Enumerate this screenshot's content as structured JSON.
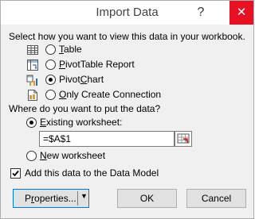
{
  "dialog": {
    "title": "Import Data",
    "help_glyph": "?",
    "close_glyph": "✕"
  },
  "view_section": {
    "prompt": "Select how you want to view this data in your workbook.",
    "options": [
      {
        "pre": "",
        "key": "T",
        "post": "able",
        "icon": "table-icon",
        "selected": false
      },
      {
        "pre": "",
        "key": "P",
        "post": "ivotTable Report",
        "icon": "pivottable-icon",
        "selected": false
      },
      {
        "pre": "Pivot",
        "key": "C",
        "post": "hart",
        "icon": "pivotchart-icon",
        "selected": true
      },
      {
        "pre": "",
        "key": "O",
        "post": "nly Create Connection",
        "icon": "connection-icon",
        "selected": false
      }
    ]
  },
  "location_section": {
    "prompt": "Where do you want to put the data?",
    "existing": {
      "pre": "",
      "key": "E",
      "post": "xisting worksheet:",
      "selected": true
    },
    "cell_ref": "=$A$1",
    "new_sheet": {
      "pre": "",
      "key": "N",
      "post": "ew worksheet",
      "selected": false
    }
  },
  "data_model": {
    "label": "Add this data to the Data Model",
    "checked": true
  },
  "buttons": {
    "properties_pre": "P",
    "properties_key": "r",
    "properties_post": "operties...",
    "ok": "OK",
    "cancel": "Cancel"
  },
  "colors": {
    "close_bg": "#e81123",
    "focus_border": "#0078d7"
  }
}
